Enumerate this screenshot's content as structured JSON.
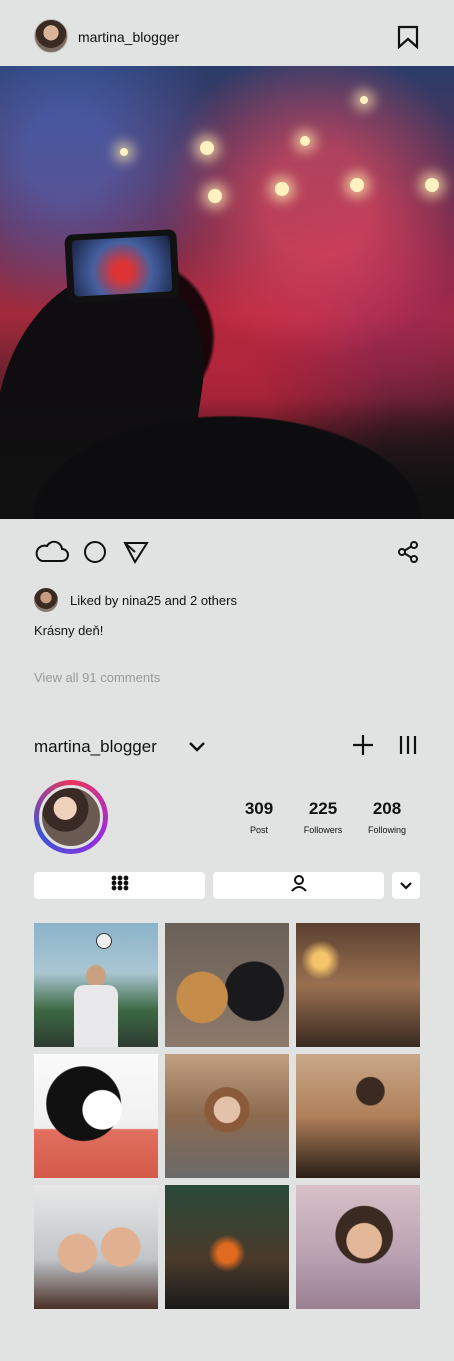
{
  "header": {
    "username": "martina_blogger",
    "bookmark_icon": "bookmark-icon"
  },
  "post": {
    "image_description_icon": "photo",
    "actions": {
      "like_icon": "cloud-icon",
      "comment_icon": "circle-icon",
      "send_icon": "send-icon",
      "share_icon": "share-icon"
    },
    "likes_text": "Liked by nina25 and 2 others",
    "caption": "Krásny deň!",
    "view_comments": "View all 91 comments"
  },
  "profile": {
    "username": "martina_blogger",
    "stats": [
      {
        "value": "309",
        "label": "Post"
      },
      {
        "value": "225",
        "label": "Followers"
      },
      {
        "value": "208",
        "label": "Following"
      }
    ],
    "tabs": {
      "grid_icon": "grid-icon",
      "tagged_icon": "person-icon",
      "more_icon": "chevron-down-icon"
    }
  },
  "colors": {
    "background": "#e1e3e3",
    "muted_text": "#9a9a9a",
    "ring_gradient": [
      "#e8365d",
      "#9b2ae0",
      "#3a54d6"
    ]
  }
}
